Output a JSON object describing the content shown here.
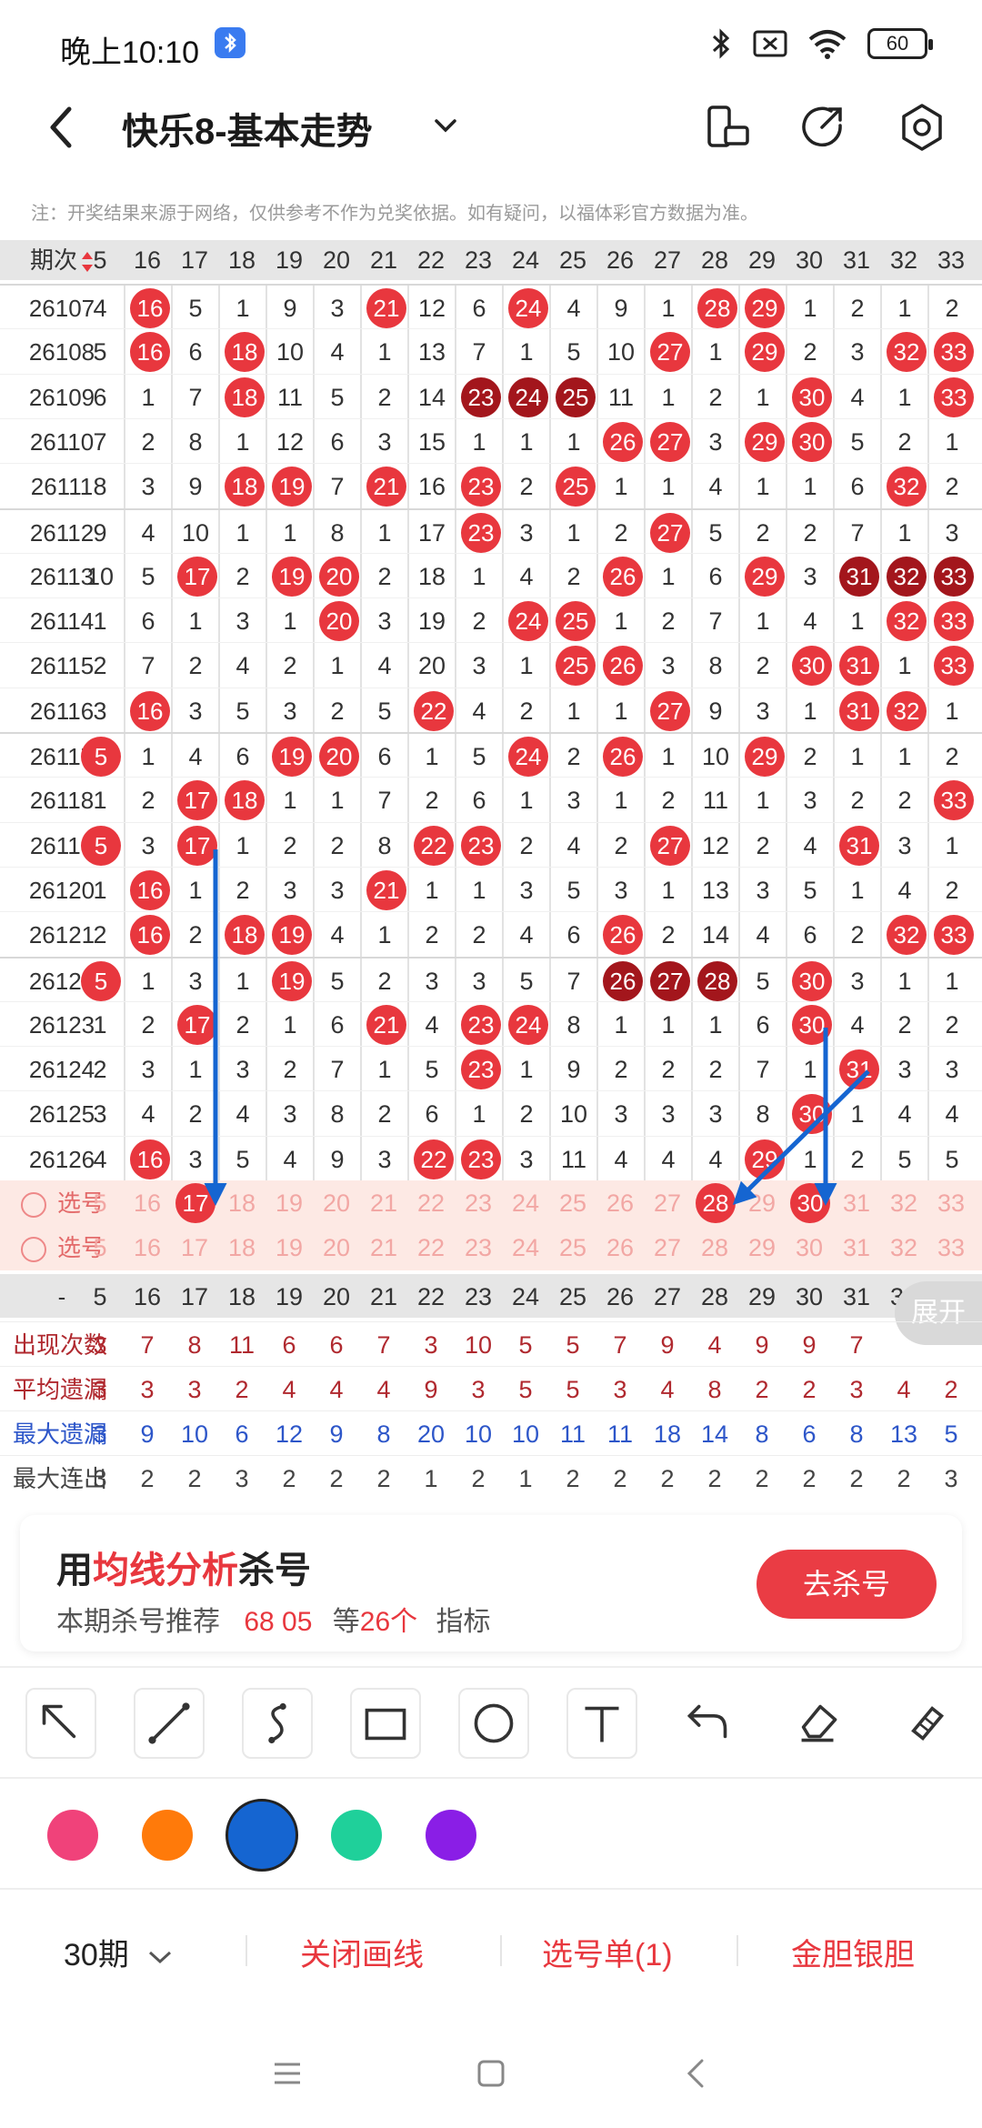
{
  "status": {
    "time": "晚上10:10",
    "battery": "60"
  },
  "header": {
    "title": "快乐8-基本走势"
  },
  "disclaimer": "注：开奖结果来源于网络，仅供参考不作为兑奖依据。如有疑问，以福体彩官方数据为准。",
  "grid": {
    "period_header": "期次",
    "columns": [
      "5",
      "16",
      "17",
      "18",
      "19",
      "20",
      "21",
      "22",
      "23",
      "24",
      "25",
      "26",
      "27",
      "28",
      "29",
      "30",
      "31",
      "32",
      "33"
    ],
    "rows": [
      {
        "period": "26107",
        "cells": [
          "4",
          "16",
          "5",
          "1",
          "9",
          "3",
          "21",
          "12",
          "6",
          "24",
          "4",
          "9",
          "1",
          "28",
          "29",
          "1",
          "2",
          "1",
          "2"
        ],
        "balls": [
          1,
          6,
          9,
          13,
          14
        ]
      },
      {
        "period": "26108",
        "cells": [
          "5",
          "16",
          "6",
          "18",
          "10",
          "4",
          "1",
          "13",
          "7",
          "1",
          "5",
          "10",
          "27",
          "1",
          "29",
          "2",
          "3",
          "32",
          "33"
        ],
        "balls": [
          1,
          3,
          12,
          14,
          17,
          18
        ]
      },
      {
        "period": "26109",
        "cells": [
          "6",
          "1",
          "7",
          "18",
          "11",
          "5",
          "2",
          "14",
          "23",
          "24",
          "25",
          "11",
          "1",
          "2",
          "1",
          "30",
          "4",
          "1",
          "33"
        ],
        "balls": [
          3,
          8,
          9,
          10,
          15,
          18
        ],
        "dark": [
          8,
          9,
          10
        ]
      },
      {
        "period": "26110",
        "cells": [
          "7",
          "2",
          "8",
          "1",
          "12",
          "6",
          "3",
          "15",
          "1",
          "1",
          "1",
          "26",
          "27",
          "3",
          "29",
          "30",
          "5",
          "2",
          "1"
        ],
        "balls": [
          11,
          12,
          14,
          15
        ]
      },
      {
        "period": "26111",
        "cells": [
          "8",
          "3",
          "9",
          "18",
          "19",
          "7",
          "21",
          "16",
          "23",
          "2",
          "25",
          "1",
          "1",
          "4",
          "1",
          "1",
          "6",
          "32",
          "2"
        ],
        "balls": [
          3,
          4,
          6,
          8,
          10,
          17
        ]
      },
      {
        "period": "26112",
        "cells": [
          "9",
          "4",
          "10",
          "1",
          "1",
          "8",
          "1",
          "17",
          "23",
          "3",
          "1",
          "2",
          "27",
          "5",
          "2",
          "2",
          "7",
          "1",
          "3"
        ],
        "balls": [
          8,
          12
        ]
      },
      {
        "period": "26113",
        "cells": [
          "10",
          "5",
          "17",
          "2",
          "19",
          "20",
          "2",
          "18",
          "1",
          "4",
          "2",
          "26",
          "1",
          "6",
          "29",
          "3",
          "31",
          "32",
          "33"
        ],
        "balls": [
          2,
          4,
          5,
          11,
          14,
          16,
          17,
          18
        ],
        "dark": [
          16,
          17,
          18
        ]
      },
      {
        "period": "26114",
        "cells": [
          "1",
          "6",
          "1",
          "3",
          "1",
          "20",
          "3",
          "19",
          "2",
          "24",
          "25",
          "1",
          "2",
          "7",
          "1",
          "4",
          "1",
          "32",
          "33"
        ],
        "balls": [
          5,
          9,
          10,
          17,
          18
        ]
      },
      {
        "period": "26115",
        "cells": [
          "2",
          "7",
          "2",
          "4",
          "2",
          "1",
          "4",
          "20",
          "3",
          "1",
          "25",
          "26",
          "3",
          "8",
          "2",
          "30",
          "31",
          "1",
          "33"
        ],
        "balls": [
          10,
          11,
          15,
          16,
          18
        ]
      },
      {
        "period": "26116",
        "cells": [
          "3",
          "16",
          "3",
          "5",
          "3",
          "2",
          "5",
          "22",
          "4",
          "2",
          "1",
          "1",
          "27",
          "9",
          "3",
          "1",
          "31",
          "32",
          "1"
        ],
        "balls": [
          1,
          7,
          12,
          16,
          17
        ]
      },
      {
        "period": "26117",
        "cells": [
          "5",
          "1",
          "4",
          "6",
          "19",
          "20",
          "6",
          "1",
          "5",
          "24",
          "2",
          "26",
          "1",
          "10",
          "29",
          "2",
          "1",
          "1",
          "2"
        ],
        "balls": [
          0,
          4,
          5,
          9,
          11,
          14
        ]
      },
      {
        "period": "26118",
        "cells": [
          "1",
          "2",
          "17",
          "18",
          "1",
          "1",
          "7",
          "2",
          "6",
          "1",
          "3",
          "1",
          "2",
          "11",
          "1",
          "3",
          "2",
          "2",
          "33"
        ],
        "balls": [
          2,
          3,
          18
        ]
      },
      {
        "period": "26119",
        "cells": [
          "5",
          "3",
          "17",
          "1",
          "2",
          "2",
          "8",
          "22",
          "23",
          "2",
          "4",
          "2",
          "27",
          "12",
          "2",
          "4",
          "31",
          "3",
          "1"
        ],
        "balls": [
          0,
          2,
          7,
          8,
          12,
          16
        ]
      },
      {
        "period": "26120",
        "cells": [
          "1",
          "16",
          "1",
          "2",
          "3",
          "3",
          "21",
          "1",
          "1",
          "3",
          "5",
          "3",
          "1",
          "13",
          "3",
          "5",
          "1",
          "4",
          "2"
        ],
        "balls": [
          1,
          6
        ]
      },
      {
        "period": "26121",
        "cells": [
          "2",
          "16",
          "2",
          "18",
          "19",
          "4",
          "1",
          "2",
          "2",
          "4",
          "6",
          "26",
          "2",
          "14",
          "4",
          "6",
          "2",
          "32",
          "33"
        ],
        "balls": [
          1,
          3,
          4,
          11,
          17,
          18
        ]
      },
      {
        "period": "26122",
        "cells": [
          "5",
          "1",
          "3",
          "1",
          "19",
          "5",
          "2",
          "3",
          "3",
          "5",
          "7",
          "26",
          "27",
          "28",
          "5",
          "30",
          "3",
          "1",
          "1"
        ],
        "balls": [
          0,
          4,
          11,
          12,
          13,
          15
        ],
        "dark": [
          11,
          12,
          13
        ]
      },
      {
        "period": "26123",
        "cells": [
          "1",
          "2",
          "17",
          "2",
          "1",
          "6",
          "21",
          "4",
          "23",
          "24",
          "8",
          "1",
          "1",
          "1",
          "6",
          "30",
          "4",
          "2",
          "2"
        ],
        "balls": [
          2,
          6,
          8,
          9,
          15
        ]
      },
      {
        "period": "26124",
        "cells": [
          "2",
          "3",
          "1",
          "3",
          "2",
          "7",
          "1",
          "5",
          "23",
          "1",
          "9",
          "2",
          "2",
          "2",
          "7",
          "1",
          "31",
          "3",
          "3"
        ],
        "balls": [
          8,
          16
        ]
      },
      {
        "period": "26125",
        "cells": [
          "3",
          "4",
          "2",
          "4",
          "3",
          "8",
          "2",
          "6",
          "1",
          "2",
          "10",
          "3",
          "3",
          "3",
          "8",
          "30",
          "1",
          "4",
          "4"
        ],
        "balls": [
          15
        ]
      },
      {
        "period": "26126",
        "cells": [
          "4",
          "16",
          "3",
          "5",
          "4",
          "9",
          "3",
          "22",
          "23",
          "3",
          "11",
          "4",
          "4",
          "4",
          "29",
          "1",
          "2",
          "5",
          "5"
        ],
        "balls": [
          1,
          7,
          8,
          14
        ]
      }
    ],
    "select_label": "选号",
    "select_rows": [
      {
        "cells": [
          "5",
          "16",
          "17",
          "18",
          "19",
          "20",
          "21",
          "22",
          "23",
          "24",
          "25",
          "26",
          "27",
          "28",
          "29",
          "30",
          "31",
          "32",
          "33"
        ],
        "balls": [
          2,
          13,
          15
        ]
      },
      {
        "cells": [
          "5",
          "16",
          "17",
          "18",
          "19",
          "20",
          "21",
          "22",
          "23",
          "24",
          "25",
          "26",
          "27",
          "28",
          "29",
          "30",
          "31",
          "32",
          "33"
        ],
        "balls": []
      }
    ],
    "footer_header": "-",
    "stats": [
      {
        "label": "出现次数",
        "color": "#b0292f",
        "cells": [
          "3",
          "7",
          "8",
          "11",
          "6",
          "6",
          "7",
          "3",
          "10",
          "5",
          "5",
          "7",
          "9",
          "4",
          "9",
          "9",
          "7",
          "",
          ""
        ]
      },
      {
        "label": "平均遗漏",
        "color": "#b0292f",
        "cells": [
          "3",
          "3",
          "3",
          "2",
          "4",
          "4",
          "4",
          "9",
          "3",
          "5",
          "5",
          "3",
          "4",
          "8",
          "2",
          "2",
          "3",
          "4",
          "2"
        ]
      },
      {
        "label": "最大遗漏",
        "color": "#2d56c9",
        "cells": [
          "3",
          "9",
          "10",
          "6",
          "12",
          "9",
          "8",
          "20",
          "10",
          "10",
          "11",
          "11",
          "18",
          "14",
          "8",
          "6",
          "8",
          "13",
          "5"
        ]
      },
      {
        "label": "最大连出",
        "color": "#444",
        "cells": [
          "3",
          "2",
          "2",
          "3",
          "2",
          "2",
          "2",
          "1",
          "2",
          "1",
          "2",
          "2",
          "2",
          "2",
          "2",
          "2",
          "2",
          "2",
          "3"
        ]
      }
    ],
    "expand_label": "展开"
  },
  "card": {
    "title_pre": "用",
    "title_hl": "均线分析",
    "title_post": "杀号",
    "sub_label": "本期杀号推荐",
    "sub_numbers": "68 05",
    "sub_mid": "等",
    "sub_count": "26个",
    "sub_post": "指标",
    "button": "去杀号"
  },
  "tools": [
    "arrow-tool-icon",
    "line-tool-icon",
    "curve-tool-icon",
    "rect-tool-icon",
    "circle-tool-icon",
    "text-tool-icon",
    "undo-icon",
    "eraser-icon",
    "clear-brush-icon"
  ],
  "colors": [
    "#f0427a",
    "#ff7a0a",
    "#1565d1",
    "#1fd09a",
    "#8a1ee6"
  ],
  "selected_color": 2,
  "actions": {
    "period": "30期",
    "close_draw": "关闭画线",
    "select_list": "选号单(1)",
    "gold_silver": "金胆银胆"
  }
}
